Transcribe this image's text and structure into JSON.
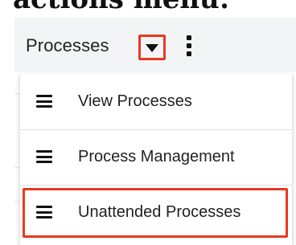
{
  "doc": {
    "heading_fragment": "actions menu:"
  },
  "topbar": {
    "module_label": "Processes",
    "caret_icon": "caret-down-icon",
    "more_icon": "vertical-ellipsis-icon"
  },
  "dropdown": {
    "items": [
      {
        "label": "View Processes",
        "icon": "hamburger-icon"
      },
      {
        "label": "Process Management",
        "icon": "hamburger-icon"
      },
      {
        "label": "Unattended Processes",
        "icon": "hamburger-icon",
        "highlighted": true
      }
    ]
  },
  "colors": {
    "highlight": "#e8381e",
    "topbar_bg": "#f3f4f6",
    "text": "#222222"
  }
}
